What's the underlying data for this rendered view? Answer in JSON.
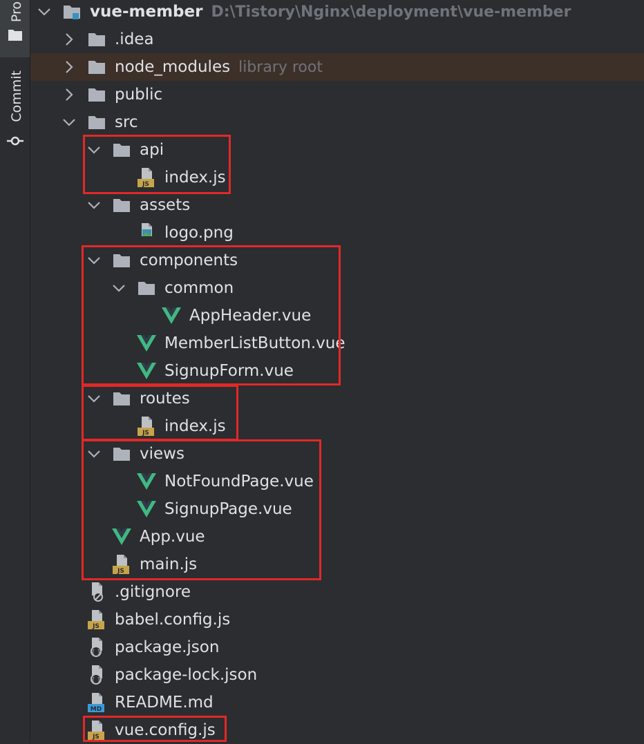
{
  "sidebar": {
    "tabs": [
      {
        "label": "Pro",
        "icon": "folder-icon"
      },
      {
        "label": "Commit",
        "icon": "commit-icon"
      }
    ]
  },
  "tree": [
    {
      "label": "vue-member",
      "hint": "D:\\Tistory\\Nginx\\deployment\\vue-member",
      "type": "module",
      "depth": 0,
      "expanded": true,
      "bold": true
    },
    {
      "label": ".idea",
      "type": "folder",
      "depth": 1,
      "expanded": false
    },
    {
      "label": "node_modules",
      "hint": "library root",
      "type": "folder",
      "depth": 1,
      "expanded": false,
      "selected": true
    },
    {
      "label": "public",
      "type": "folder",
      "depth": 1,
      "expanded": false
    },
    {
      "label": "src",
      "type": "folder",
      "depth": 1,
      "expanded": true
    },
    {
      "label": "api",
      "type": "folder",
      "depth": 2,
      "expanded": true
    },
    {
      "label": "index.js",
      "type": "js",
      "depth": 3
    },
    {
      "label": "assets",
      "type": "folder",
      "depth": 2,
      "expanded": true
    },
    {
      "label": "logo.png",
      "type": "image",
      "depth": 3
    },
    {
      "label": "components",
      "type": "folder",
      "depth": 2,
      "expanded": true
    },
    {
      "label": "common",
      "type": "folder",
      "depth": 3,
      "expanded": true
    },
    {
      "label": "AppHeader.vue",
      "type": "vue",
      "depth": 4
    },
    {
      "label": "MemberListButton.vue",
      "type": "vue",
      "depth": 3
    },
    {
      "label": "SignupForm.vue",
      "type": "vue",
      "depth": 3
    },
    {
      "label": "routes",
      "type": "folder",
      "depth": 2,
      "expanded": true
    },
    {
      "label": "index.js",
      "type": "js",
      "depth": 3
    },
    {
      "label": "views",
      "type": "folder",
      "depth": 2,
      "expanded": true
    },
    {
      "label": "NotFoundPage.vue",
      "type": "vue",
      "depth": 3
    },
    {
      "label": "SignupPage.vue",
      "type": "vue",
      "depth": 3
    },
    {
      "label": "App.vue",
      "type": "vue",
      "depth": 2
    },
    {
      "label": "main.js",
      "type": "js",
      "depth": 2
    },
    {
      "label": ".gitignore",
      "type": "ignore",
      "depth": 1
    },
    {
      "label": "babel.config.js",
      "type": "js",
      "depth": 1
    },
    {
      "label": "package.json",
      "type": "json",
      "depth": 1
    },
    {
      "label": "package-lock.json",
      "type": "json",
      "depth": 1
    },
    {
      "label": "README.md",
      "type": "md",
      "depth": 1
    },
    {
      "label": "vue.config.js",
      "type": "js",
      "depth": 1
    }
  ],
  "colors": {
    "background": "#2b2d30",
    "selected_row": "#3d3029",
    "highlight_box": "#e22828",
    "vue_green": "#41b883",
    "js_yellow": "#c7a44a",
    "md_blue": "#3a9ad9"
  }
}
